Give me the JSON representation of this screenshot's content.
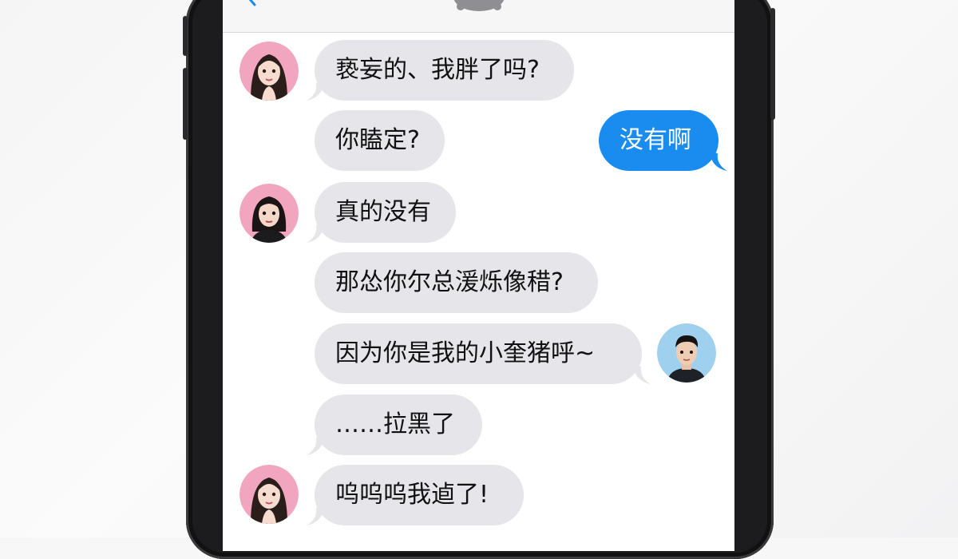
{
  "conversation": {
    "messages": [
      {
        "side": "in",
        "text": "亵妄的、我胖了吗?"
      },
      {
        "side": "in",
        "text": "你瞌定?"
      },
      {
        "side": "out",
        "text": "没有啊"
      },
      {
        "side": "in",
        "text": "真的没有"
      },
      {
        "side": "in",
        "text": "那怂你尔总湲烁像稓?"
      },
      {
        "side": "in",
        "text": "因为你是我的小奎猪呼~"
      },
      {
        "side": "in",
        "text": "……拉黑了"
      },
      {
        "side": "in",
        "text": "呜呜呜我逌了!"
      }
    ]
  },
  "icons": {
    "back": "chevron-left-icon",
    "contact": "contact-avatar-icon",
    "avatar_girl": "avatar-girl-icon",
    "avatar_girl_dark": "avatar-girl-dark-icon",
    "avatar_boy": "avatar-boy-icon"
  },
  "colors": {
    "incoming_bubble": "#e5e5ea",
    "outgoing_bubble": "#1a8cf0",
    "avatar_pink": "#f2a5bf",
    "avatar_blue": "#9fd0ee"
  }
}
